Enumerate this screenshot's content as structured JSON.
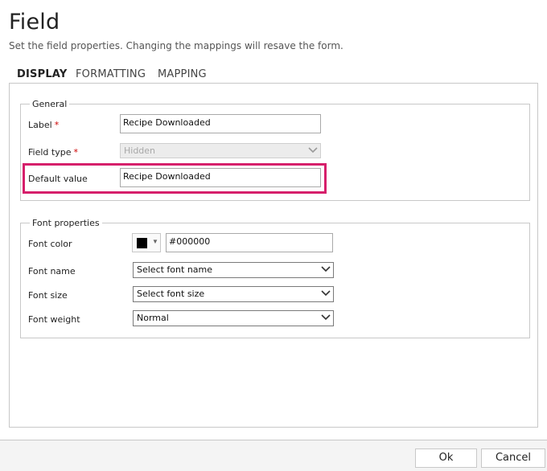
{
  "header": {
    "title": "Field",
    "subtitle": "Set the field properties. Changing the mappings will resave the form."
  },
  "tabs": [
    {
      "label": "DISPLAY",
      "active": true
    },
    {
      "label": "FORMATTING",
      "active": false
    },
    {
      "label": "MAPPING",
      "active": false
    }
  ],
  "general": {
    "legend": "General",
    "label_label": "Label",
    "label_value": "Recipe Downloaded",
    "field_type_label": "Field type",
    "field_type_value": "Hidden",
    "field_type_disabled": true,
    "default_value_label": "Default value",
    "default_value_value": "Recipe Downloaded",
    "required_mark": "*"
  },
  "font": {
    "legend": "Font properties",
    "color_label": "Font color",
    "color_value": "#000000",
    "swatch_color": "#000000",
    "name_label": "Font name",
    "name_value": "Select font name",
    "size_label": "Font size",
    "size_value": "Select font size",
    "weight_label": "Font weight",
    "weight_value": "Normal"
  },
  "footer": {
    "ok_label": "Ok",
    "cancel_label": "Cancel"
  },
  "colors": {
    "highlight": "#d61f6b",
    "required": "#cc0000"
  },
  "icons": {
    "select_arrow": "chevron-down-icon",
    "color_picker_caret": "caret-down-icon"
  }
}
